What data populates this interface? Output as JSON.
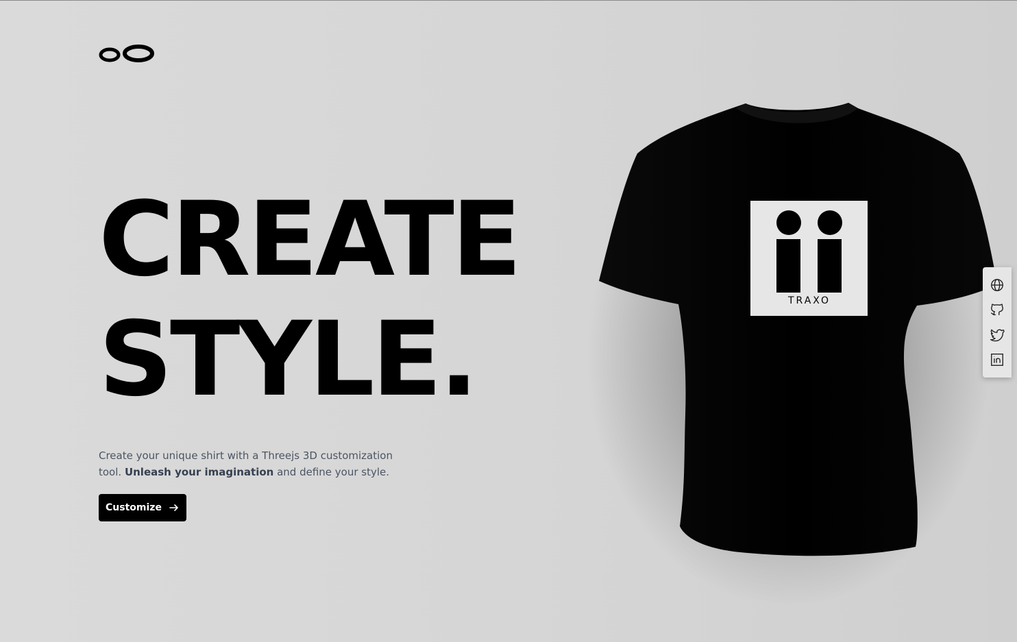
{
  "logo": {
    "icon": "brand-logo-icon"
  },
  "hero": {
    "line1": "CREATE",
    "line2": "STYLE."
  },
  "intro": {
    "text_part1": "Create your unique shirt with a Threejs 3D customization tool. ",
    "text_bold": "Unleash your imagination",
    "text_part2": " and define your style."
  },
  "cta": {
    "label": "Customize",
    "icon": "arrow-right-icon"
  },
  "shirt": {
    "color": "#000000",
    "decal_text": "TRAXO"
  },
  "social": {
    "items": [
      {
        "icon": "globe-icon"
      },
      {
        "icon": "github-icon"
      },
      {
        "icon": "twitter-icon"
      },
      {
        "icon": "linkedin-icon"
      }
    ]
  }
}
